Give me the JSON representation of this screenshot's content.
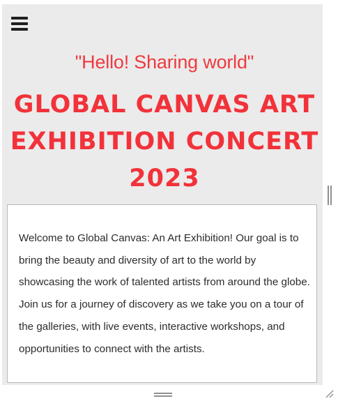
{
  "header": {
    "menu_icon": "hamburger-menu-icon"
  },
  "hero": {
    "subtitle": "\"Hello! Sharing world\"",
    "title_line_1": "Global Canvas Art",
    "title_line_2": "Exhibition Concert",
    "title_line_3": "2023"
  },
  "welcome": {
    "text": "Welcome to Global Canvas: An Art Exhibition! Our goal is to bring the beauty and diversity of art to the world by showcasing the work of talented artists from around the globe. Join us for a journey of discovery as we take you on a tour of the galleries, with live events, interactive workshops, and opportunities to connect with the artists."
  },
  "colors": {
    "accent": "#f2323a",
    "pane_background": "#ebebeb",
    "card_background": "#ffffff",
    "body_text": "#2c2c2c"
  },
  "icons": {
    "vertical_splitter": "vertical-resize-handle-icon",
    "horizontal_splitter": "horizontal-resize-handle-icon",
    "corner_grip": "resize-grip-icon"
  }
}
